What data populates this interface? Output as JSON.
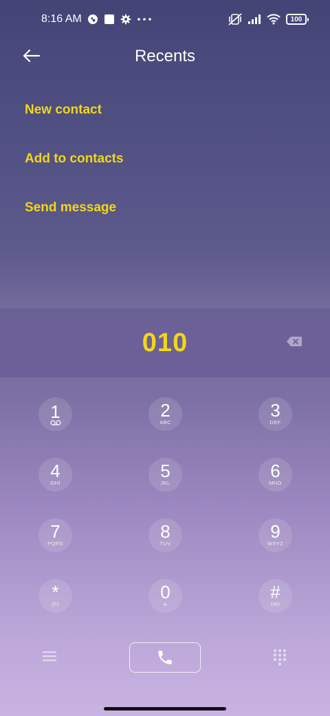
{
  "status_bar": {
    "time": "8:16 AM",
    "battery": "100",
    "icons": [
      "notification-icon",
      "square-icon",
      "gear-icon",
      "more-dots-icon",
      "vibrate-off-icon",
      "signal-icon",
      "wifi-icon",
      "battery-icon"
    ]
  },
  "header": {
    "title": "Recents"
  },
  "menu": {
    "new_contact": "New contact",
    "add_to_contacts": "Add to contacts",
    "send_message": "Send message"
  },
  "dialer": {
    "number": "010"
  },
  "keypad": {
    "k1": {
      "digit": "1",
      "sub": ""
    },
    "k2": {
      "digit": "2",
      "sub": "ABC"
    },
    "k3": {
      "digit": "3",
      "sub": "DEF"
    },
    "k4": {
      "digit": "4",
      "sub": "GHI"
    },
    "k5": {
      "digit": "5",
      "sub": "JKL"
    },
    "k6": {
      "digit": "6",
      "sub": "MNO"
    },
    "k7": {
      "digit": "7",
      "sub": "PQRS"
    },
    "k8": {
      "digit": "8",
      "sub": "TUV"
    },
    "k9": {
      "digit": "9",
      "sub": "WXYZ"
    },
    "kstar": {
      "digit": "*",
      "sub": "(P)"
    },
    "k0": {
      "digit": "0",
      "sub": "+"
    },
    "khash": {
      "digit": "#",
      "sub": "(W)"
    }
  },
  "colors": {
    "accent": "#f1d716",
    "background_top": "#434476",
    "background_bottom": "#c9b3e2"
  }
}
